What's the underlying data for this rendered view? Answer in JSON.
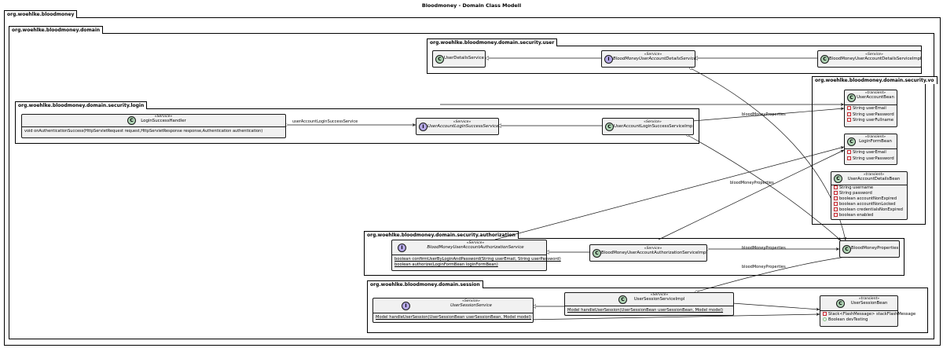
{
  "title": "Bloodmoney - Domain Class Modell",
  "packages": {
    "root": "org.woehlke.bloodmoney",
    "domain": "org.woehlke.bloodmoney.domain",
    "user": "org.woehlke.bloodmoney.domain.security.user",
    "vo": "org.woehlke.bloodmoney.domain.security.vo",
    "login": "org.woehlke.bloodmoney.domain.security.login",
    "authorization": "org.woehlke.bloodmoney.domain.security.authorization",
    "session": "org.woehlke.bloodmoney.domain.session"
  },
  "classes": {
    "userDetailsService": {
      "kind": "C",
      "name": "UserDetailsService"
    },
    "bmUserAccountDetailsService": {
      "kind": "I",
      "stereotype": "«Service»",
      "name": "BloodMoneyUserAccountDetailsService"
    },
    "bmUserAccountDetailsServiceImpl": {
      "kind": "C",
      "stereotype": "«Service»",
      "name": "BloodMoneyUserAccountDetailsServiceImpl"
    },
    "userAccountBean": {
      "kind": "C",
      "stereotype": "«transient»",
      "name": "UserAccountBean",
      "members": [
        "String userEmail",
        "String userPassword",
        "String userFullname"
      ]
    },
    "loginFormBean": {
      "kind": "C",
      "stereotype": "«transient»",
      "name": "LoginFormBean",
      "members": [
        "String userEmail",
        "String userPassword"
      ]
    },
    "userAccountDetailsBean": {
      "kind": "C",
      "stereotype": "«transient»",
      "name": "UserAccountDetailsBean",
      "members": [
        "String username",
        "String password",
        "boolean accountNonExpired",
        "boolean accountNonLocked",
        "boolean credentialsNonExpired",
        "boolean enabled"
      ]
    },
    "loginSuccessHandler": {
      "kind": "C",
      "stereotype": "«Service»",
      "name": "LoginSuccessHandler",
      "methods": [
        "void onAuthenticationSuccess(HttpServletRequest request,HttpServletResponse response,Authentication authentication)"
      ]
    },
    "userAccountLoginSuccessService": {
      "kind": "I",
      "stereotype": "«Service»",
      "name": "UserAccountLoginSuccessService"
    },
    "userAccountLoginSuccessServiceImpl": {
      "kind": "C",
      "stereotype": "«Service»",
      "name": "UserAccountLoginSuccessServiceImpl"
    },
    "bmUserAccountAuthorizationService": {
      "kind": "I",
      "stereotype": "«Service»",
      "name": "BloodMoneyUserAccountAuthorizationService",
      "methods": [
        "boolean confirmUserByLoginAndPassword(String userEmail, String userPassword)",
        "boolean authorize(LoginFormBean loginFormBean)"
      ]
    },
    "bmUserAccountAuthorizationServiceImpl": {
      "kind": "C",
      "stereotype": "«Service»",
      "name": "BloodMoneyUserAccountAuthorizationServiceImpl"
    },
    "bloodMoneyProperties": {
      "kind": "C",
      "name": "BloodMoneyProperties"
    },
    "userSessionService": {
      "kind": "I",
      "stereotype": "«Service»",
      "name": "UserSessionService",
      "methods": [
        "Model handleUserSession(UserSessionBean userSessionBean, Model model)"
      ]
    },
    "userSessionServiceImpl": {
      "kind": "C",
      "stereotype": "«Service»",
      "name": "UserSessionServiceImpl",
      "methods": [
        "Model handleUserSession(UserSessionBean userSessionBean, Model model)"
      ]
    },
    "userSessionBean": {
      "kind": "C",
      "stereotype": "«transient»",
      "name": "UserSessionBean",
      "members": [
        "Stack<FlashMessage> stackFlashMessage",
        "Boolean devTesting"
      ]
    }
  },
  "links": {
    "userAccountLoginSuccessService": "userAccountLoginSuccessService",
    "bloodMoneyProperties1": "bloodMoneyProperties",
    "bloodMoneyProperties2": "bloodMoneyProperties",
    "bloodMoneyProperties3": "bloodMoneyProperties",
    "bloodMoneyProperties4": "bloodMoneyProperties"
  }
}
